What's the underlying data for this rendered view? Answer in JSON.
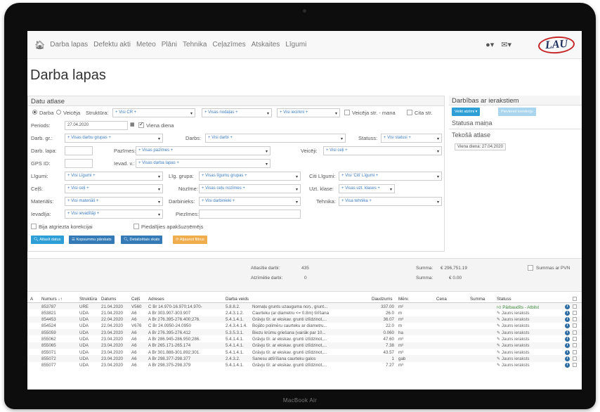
{
  "laptop_label": "MacBook Air",
  "nav": {
    "items": [
      "Darba lapas",
      "Defektu akti",
      "Meteo",
      "Plāni",
      "Tehnika",
      "Ceļazīmes",
      "Atskaites",
      "Līgumi"
    ],
    "user_icon": "user-icon",
    "mail_icon": "envelope-icon",
    "logo_text": "LAU"
  },
  "page_title": "Darba lapas",
  "filters": {
    "heading": "Datu atlase",
    "row1": {
      "radio1": "Darba",
      "radio2": "Veicēja",
      "struktura_label": "Struktūra:",
      "struktura": "+ Visi CR +",
      "nodalas": "+ Visas nodaļas +",
      "iecirkni": "+ Visi iecirkni +",
      "veiceja_str": "Veicēja str. - mana",
      "cita_str": "Cita str."
    },
    "row2": {
      "periods_label": "Periods:",
      "periods": "27.04.2020",
      "viena_diena": "Viena diena"
    },
    "row3": {
      "darb_gr_label": "Darb. gr.:",
      "darb_gr": "+ Visas darbu grupas +",
      "darbs_label": "Darbs:",
      "darbs": "+ Visi darbi +",
      "statuss_label": "Statuss:",
      "statuss": "+ Visi statusi +"
    },
    "row4": {
      "darb_lapa_label": "Darb. lapa:",
      "pazimes_label": "Pazīmes:",
      "pazimes": "+ Visas pazīmes +",
      "veiceji_label": "Veicēji:",
      "veiceji": "+ Visi ceļi +"
    },
    "row5": {
      "gps_label": "GPS ID:",
      "ievad_label": "Ievad. v.:",
      "ievad": "+ Visas darba lapas +"
    },
    "row6": {
      "ligumi_label": "Līgumi:",
      "ligumi": "+ Visi Līgumi +",
      "lig_grupa_label": "Līg. grupa:",
      "lig_grupa": "+ Visas līgumu grupas +",
      "citi_ligumi_label": "Citi Līgumi:",
      "citi_ligumi": "+ Visi 'Citi' Līgumi +"
    },
    "row7": {
      "celi_label": "Ceļš:",
      "celi": "+ Visi ceļi +",
      "nozime_label": "Nozīme:",
      "nozime": "+ Visas ceļu nozīmes +",
      "uzt_klase_label": "Uzt. klase:",
      "uzt_klase": "+ Visas uzt. klases +"
    },
    "row8": {
      "materials_label": "Materiāls:",
      "materials": "+ Visi materiāli +",
      "darbinieks_label": "Darbinieks:",
      "darbinieks": "+ Visi darbinieki +",
      "tehnika_label": "Tehnika:",
      "tehnika": "+ Visa tehnika +"
    },
    "row9": {
      "ievadija_label": "Ievadīja:",
      "ievadija": "+ Visi ievadītāji +",
      "piezimes_label": "Piezīmes:"
    },
    "row10": {
      "bija_korekcijai": "Bija atgriezta korekcijai",
      "apaksuznemejs": "Piedalījies apakšuzņēmējs"
    },
    "buttons": {
      "atlasit": "Atlasīt datus",
      "kopsummu": "Kopsummu pārskats",
      "detalizetais": "Detalizētais skats",
      "atjaunot": "Atjaunot filtrus"
    }
  },
  "right_panel": {
    "heading": "Darbības ar ierakstiem",
    "btn1": "Veikt atzīmi ▾",
    "btn2": "Pievienot korekciju",
    "status_change": "Statusa maiņa",
    "current_heading": "Tekošā atlase",
    "current_tag": "Viena diena: 27.04.2020"
  },
  "summary": {
    "atlasitie_label": "Atlasītie darbi:",
    "atlasitie_val": "435",
    "atzimetie_label": "Atzīmētie darbi:",
    "atzimetie_val": "0",
    "summa1_label": "Summa:",
    "summa1_val": "€ 296,751.19",
    "summa2_label": "Summa:",
    "summa2_val": "€ 0.00",
    "pvn_label": "Summas ar PVN"
  },
  "table": {
    "headers": {
      "a": "A",
      "numurs": "Numurs ↓↑",
      "struktura": "Struktūra",
      "datums": "Datums",
      "cels": "Ceļš",
      "adreses": "Adreses",
      "darba_veids": "Darba veids",
      "daudzums": "Daudzums",
      "merv": "Mērv.",
      "cena": "Cena",
      "summa": "Summa",
      "statuss": "Statuss"
    },
    "rows": [
      {
        "num": "853787",
        "str": "URE",
        "dat": "21.04.2020",
        "cel": "V560",
        "adr": "C Br 14.970-16.970;14.970-",
        "code": "5.8.8.2.",
        "desc": "Nomaļu grunts uzauguma noņ., grunt...",
        "qty": "337.00",
        "unit": "m²",
        "status": "Pārbaudīts - Atbilst",
        "ok": true
      },
      {
        "num": "853821",
        "str": "UDA",
        "dat": "21.04.2020",
        "cel": "A6",
        "adr": "A Br 303.907-303.907",
        "code": "2.4.3.1.2.",
        "desc": "Caurteku (ar diametru <= 0.8m) tīrīšana",
        "qty": "26.0",
        "unit": "m",
        "status": "Jauns ieraksts",
        "ok": false
      },
      {
        "num": "854453",
        "str": "UDA",
        "dat": "22.04.2020",
        "cel": "A6",
        "adr": "A Br 276.395-276.400;276.",
        "code": "5.4.1.4.1.",
        "desc": "Grāvju tīr. ar ekskav. grunti izlīdzinot,...",
        "qty": "36.07",
        "unit": "m³",
        "status": "Jauns ieraksts",
        "ok": false
      },
      {
        "num": "854524",
        "str": "UDA",
        "dat": "22.04.2020",
        "cel": "V676",
        "adr": "C Br 24.0950-24.0950",
        "code": "2.4.3.4.1.4.",
        "desc": "Bojāto polimēru caurteku ar diametru...",
        "qty": "22.0",
        "unit": "m",
        "status": "Jauns ieraksts",
        "ok": false
      },
      {
        "num": "855059",
        "str": "UDA",
        "dat": "23.04.2020",
        "cel": "A6",
        "adr": "A Br 276.395-276.412",
        "code": "5.3.5.3.1.",
        "desc": "Biezu krūmu griešana (vairāk par 10...",
        "qty": "0.060",
        "unit": "ha",
        "status": "Jauns ieraksts",
        "ok": false
      },
      {
        "num": "855062",
        "str": "UDA",
        "dat": "23.04.2020",
        "cel": "A6",
        "adr": "A Br 286.945-286.950;286.",
        "code": "5.4.1.4.1.",
        "desc": "Grāvju tīr. ar ekskav. grunti izlīdzinot,...",
        "qty": "47.60",
        "unit": "m³",
        "status": "Jauns ieraksts",
        "ok": false
      },
      {
        "num": "855065",
        "str": "UDA",
        "dat": "23.04.2020",
        "cel": "A6",
        "adr": "A Br 265.171-265.174",
        "code": "5.4.1.4.1.",
        "desc": "Grāvju tīr. ar ekskav. grunti izlīdzinot,...",
        "qty": "7.38",
        "unit": "m³",
        "status": "Jauns ieraksts",
        "ok": false
      },
      {
        "num": "855071",
        "str": "UDA",
        "dat": "23.04.2020",
        "cel": "A6",
        "adr": "A Br 301.888-301.892;301.",
        "code": "5.4.1.4.1.",
        "desc": "Grāvju tīr. ar ekskav. grunti izlīdzinot,...",
        "qty": "43.57",
        "unit": "m³",
        "status": "Jauns ieraksts",
        "ok": false
      },
      {
        "num": "855072",
        "str": "UDA",
        "dat": "23.04.2020",
        "cel": "A6",
        "adr": "A Br 298.377-298.377",
        "code": "2.4.3.2.",
        "desc": "Sanesu attīrīšana caurteku galos",
        "qty": "1",
        "unit": "gab",
        "status": "Jauns ieraksts",
        "ok": false
      },
      {
        "num": "855077",
        "str": "UDA",
        "dat": "23.04.2020",
        "cel": "A6",
        "adr": "A Br 298.375-298.379",
        "code": "5.4.1.4.1.",
        "desc": "Grāvju tīr. ar ekskav. grunti izlīdzinot,...",
        "qty": "7.27",
        "unit": "m³",
        "status": "Jauns ieraksts",
        "ok": false
      }
    ]
  },
  "colors": {
    "btn_blue": "#2e9fd6",
    "btn_darkblue": "#337ab7",
    "btn_orange": "#f0ad4e",
    "btn_light": "#a9d5ef",
    "status_green": "#3b8a3b",
    "logo_red": "#c62828"
  }
}
